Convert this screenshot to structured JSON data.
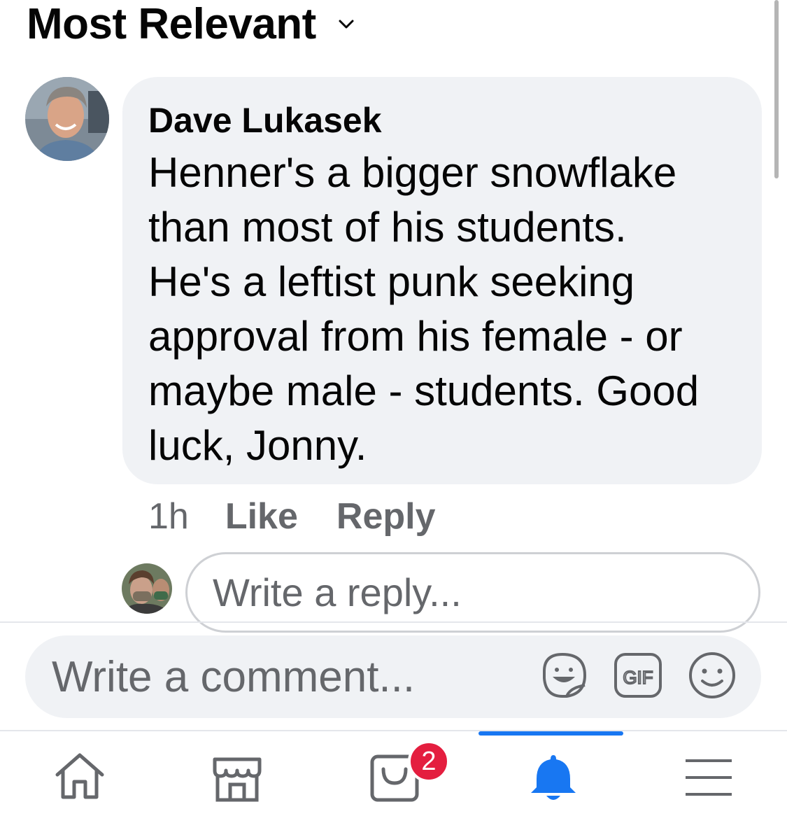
{
  "header": {
    "sort_label": "Most Relevant"
  },
  "comment": {
    "author": "Dave Lukasek",
    "text_lines": [
      "Henner's a bigger snowflake",
      "than most of his students.",
      "He's a leftist punk seeking",
      "approval from his female - or",
      "maybe male - students. Good",
      "luck, Jonny."
    ],
    "time": "1h",
    "like_label": "Like",
    "reply_label": "Reply"
  },
  "reply_box": {
    "placeholder": "Write a reply..."
  },
  "composer": {
    "placeholder": "Write a comment...",
    "icons": [
      "sticker-icon",
      "gif-icon",
      "emoji-icon"
    ],
    "gif_label": "GIF"
  },
  "tabbar": {
    "items": [
      {
        "name": "home-icon"
      },
      {
        "name": "marketplace-icon"
      },
      {
        "name": "shop-icon",
        "badge": "2"
      },
      {
        "name": "notifications-bell-icon",
        "active": true
      },
      {
        "name": "menu-icon"
      }
    ],
    "accent": "#1877f2",
    "badge_color": "#e41e3f"
  }
}
